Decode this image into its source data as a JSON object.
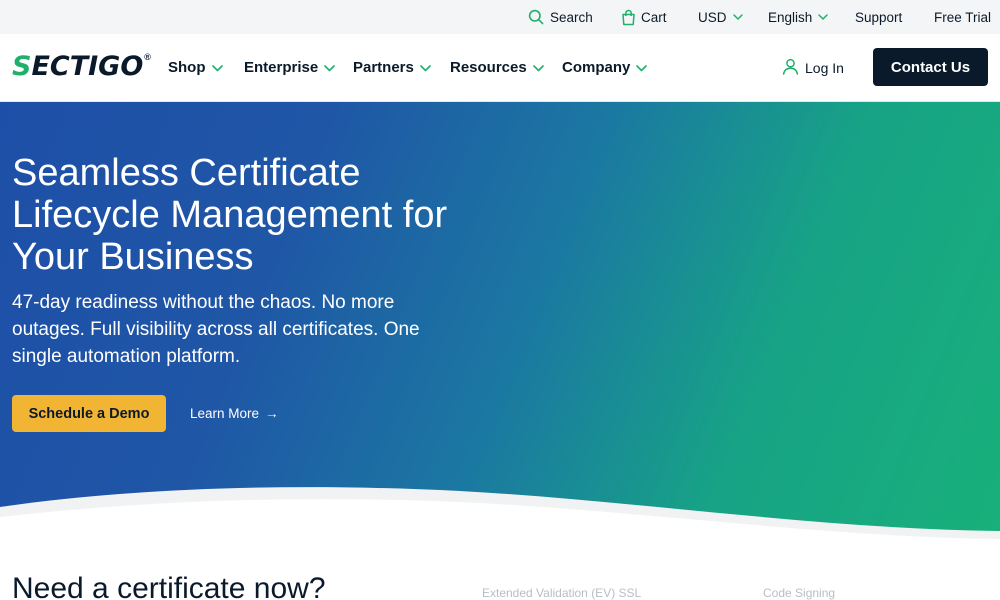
{
  "utility_bar": {
    "search_label": "Search",
    "cart_label": "Cart",
    "currency_label": "USD",
    "language_label": "English",
    "support_label": "Support",
    "free_trial_label": "Free Trial"
  },
  "brand": {
    "logo_first": "S",
    "logo_rest": "ECTIGO",
    "logo_mark": "®"
  },
  "nav": {
    "items": [
      {
        "label": "Shop"
      },
      {
        "label": "Enterprise"
      },
      {
        "label": "Partners"
      },
      {
        "label": "Resources"
      },
      {
        "label": "Company"
      }
    ],
    "login_label": "Log In",
    "contact_label": "Contact Us"
  },
  "hero": {
    "title": "Seamless Certificate Lifecycle Management for Your Business",
    "subtitle": "47-day readiness without the chaos. No more outages. Full visibility across all certificates. One single automation platform.",
    "primary_cta": "Schedule a Demo",
    "secondary_cta": "Learn More",
    "secondary_arrow": "→"
  },
  "below_fold": {
    "section_title": "Need a certificate now?",
    "tab_1": "Extended Validation (EV) SSL",
    "tab_2": "Code Signing"
  },
  "colors": {
    "brand_green": "#1fb06c",
    "navy": "#0b1a2b",
    "cta_yellow": "#f2b533",
    "hero_blue": "#1e4fa8",
    "hero_teal": "#18b07a"
  },
  "icons": {
    "search": "search-icon",
    "cart": "cart-icon",
    "chevron": "chevron-down-icon",
    "user": "user-icon",
    "arrow": "arrow-right-icon"
  }
}
